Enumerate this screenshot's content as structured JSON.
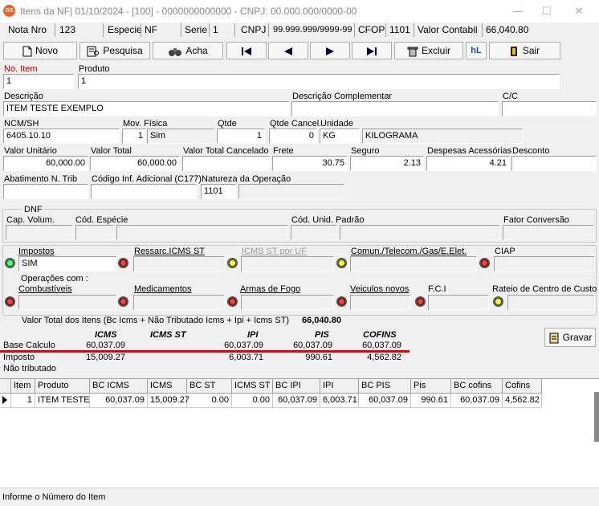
{
  "window": {
    "title": "Itens da NF| 01/10/2024 - [100] - 0000000000000 - CNPJ: 00.000.000/0000-00",
    "icon_text": "GS",
    "minimize": "—",
    "maximize": "☐",
    "close": "✕"
  },
  "header": {
    "nota_label": "Nota Nro",
    "nota_value": "123",
    "especie_label": "Especie",
    "especie_value": "NF",
    "serie_label": "Serie",
    "serie_value": "1",
    "cnpj_label": "CNPJ",
    "cnpj_value": "99.999.999/9999-99",
    "cfop_label": "CFOP",
    "cfop_value": "1101",
    "valor_label": "Valor Contabil",
    "valor_value": "66,040.80"
  },
  "toolbar": {
    "novo": "Novo",
    "pesquisa": "Pesquisa",
    "acha": "Acha",
    "excluir": "Excluir",
    "sair": "Sair",
    "hl_icon_text": "hL"
  },
  "form": {
    "no_item_label": "No. Item",
    "no_item": "1",
    "produto_label": "Produto",
    "produto": "1",
    "descricao_label": "Descrição",
    "descricao": "ITEM TESTE EXEMPLO",
    "desc_comp_label": "Descrição Complementar",
    "desc_comp": "",
    "cc_label": "C/C",
    "cc": "",
    "ncm_label": "NCM/SH",
    "ncm": "6405.10.10",
    "mov_label": "Mov. Física",
    "mov_code": "1",
    "mov_value": "Sim",
    "qtde_label": "Qtde",
    "qtde": "1",
    "qtde_cancel_label": "Qtde Cancel.",
    "qtde_cancel": "0",
    "unidade_label": "Unidade",
    "unidade_code": "KG",
    "unidade_desc": "KILOGRAMA",
    "valor_unit_label": "Valor Unitário",
    "valor_unit": "60,000.00",
    "valor_total_label": "Valor Total",
    "valor_total": "60,000.00",
    "valor_cancel_label": "Valor Total Cancelado",
    "valor_cancel": "",
    "frete_label": "Frete",
    "frete": "30.75",
    "seguro_label": "Seguro",
    "seguro": "2.13",
    "despesas_label": "Despesas Acessórias",
    "despesas": "4.21",
    "desconto_label": "Desconto",
    "desconto": "",
    "abatimento_label": "Abatimento N. Trib",
    "abatimento": "",
    "codigo_label": "Código Inf. Adicional (C177)",
    "codigo": "",
    "natureza_label": "Natureza da Operação",
    "natureza": "1101",
    "natureza_desc": ""
  },
  "dnf": {
    "title": "DNF",
    "cap_label": "Cap. Volum.",
    "cod_esp_label": "Cód. Espécie",
    "cod_unid_label": "Cód. Unid. Padrão",
    "fator_label": "Fator Conversão"
  },
  "impostos": {
    "impostos_label": "Impostos",
    "impostos_value": "SIM",
    "ressarc_label": "Ressarc.ICMS ST",
    "icms_st_uf_label": "ICMS ST por UF",
    "comun_label": "Comun./Telecom./Gas/E.Elet.",
    "ciap_label": "CIAP",
    "operacoes_label": "Operações com :",
    "combustiveis_label": "Combustíveis",
    "medicamentos_label": "Medicamentos",
    "armas_label": "Armas de Fogo",
    "veiculos_label": "Veiculos novos",
    "fci_label": "F.C.I",
    "rateio_label": "Rateio de Centro de Custo"
  },
  "summary": {
    "valor_total_itens_label": "Valor Total dos Itens  (Bc Icms + Não Tributado Icms + Ipi + Icms ST)",
    "valor_total_itens": "66,040.80",
    "headers": {
      "icms": "ICMS",
      "icms_st": "ICMS ST",
      "ipi": "IPI",
      "pis": "PIS",
      "cofins": "COFINS"
    },
    "base_label": "Base Calculo",
    "imposto_label": "Imposto",
    "nao_trib_label": "Não tributado",
    "base": {
      "icms": "60,037.09",
      "ipi": "60,037.09",
      "pis": "60,037.09",
      "cofins": "60,037.09"
    },
    "imposto": {
      "icms": "15,009.27",
      "ipi": "6,003.71",
      "pis": "990.61",
      "cofins": "4,562.82"
    },
    "gravar": "Gravar"
  },
  "grid": {
    "columns": [
      "Item",
      "Produto",
      "BC ICMS",
      "ICMS",
      "BC ST",
      "ICMS ST",
      "BC IPI",
      "IPI",
      "BC PIS",
      "Pis",
      "BC cofins",
      "Cofins"
    ],
    "rows": [
      [
        "1",
        "ITEM TESTE",
        "60,037.09",
        "15,009.27",
        "0.00",
        "0.00",
        "60,037.09",
        "6,003.71",
        "60,037.09",
        "990.61",
        "60,037.09",
        "4,562.82"
      ]
    ]
  },
  "status": "Informe o Número do Item",
  "colors": {
    "accent_red": "#e0000a",
    "label_red": "#c00000"
  }
}
